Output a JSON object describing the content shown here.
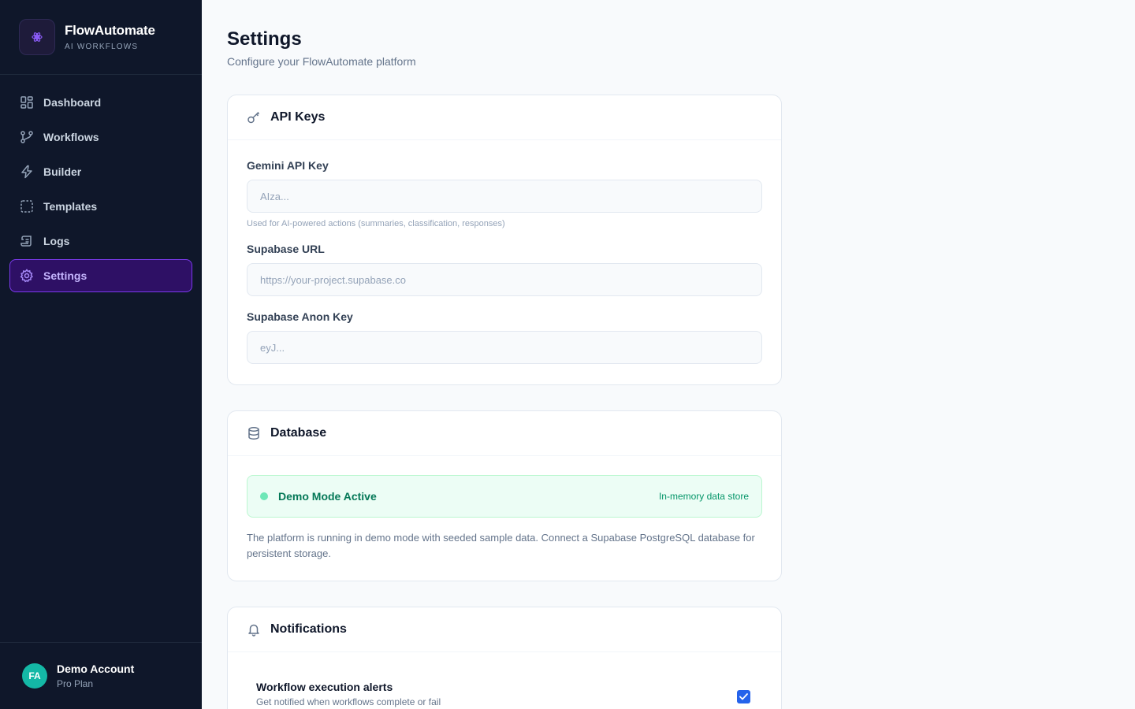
{
  "brand": {
    "name": "FlowAutomate",
    "tagline": "AI WORKFLOWS"
  },
  "nav": [
    {
      "label": "Dashboard",
      "icon": "dashboard-grid-icon"
    },
    {
      "label": "Workflows",
      "icon": "git-branch-icon"
    },
    {
      "label": "Builder",
      "icon": "lightning-icon"
    },
    {
      "label": "Templates",
      "icon": "template-dashed-icon"
    },
    {
      "label": "Logs",
      "icon": "scroll-icon"
    },
    {
      "label": "Settings",
      "icon": "gear-icon",
      "active": true
    }
  ],
  "account": {
    "initials": "FA",
    "name": "Demo Account",
    "plan": "Pro Plan"
  },
  "page": {
    "title": "Settings",
    "subtitle": "Configure your FlowAutomate platform"
  },
  "api_keys": {
    "title": "API Keys",
    "icon": "key-icon",
    "gemini": {
      "label": "Gemini API Key",
      "placeholder": "AIza...",
      "value": "",
      "help": "Used for AI-powered actions (summaries, classification, responses)"
    },
    "supabase_url": {
      "label": "Supabase URL",
      "placeholder": "https://your-project.supabase.co",
      "value": ""
    },
    "supabase_anon": {
      "label": "Supabase Anon Key",
      "placeholder": "eyJ...",
      "value": ""
    }
  },
  "database": {
    "title": "Database",
    "icon": "database-icon",
    "status_label": "Demo Mode Active",
    "status_detail": "In-memory data store",
    "description": "The platform is running in demo mode with seeded sample data. Connect a Supabase PostgreSQL database for persistent storage."
  },
  "notifications": {
    "title": "Notifications",
    "icon": "bell-icon",
    "items": [
      {
        "title": "Workflow execution alerts",
        "subtitle": "Get notified when workflows complete or fail",
        "checked": true
      }
    ]
  },
  "colors": {
    "sidebar_bg": "#0f172a",
    "accent": "#7c3aed",
    "success": "#047857",
    "checkbox": "#2563eb"
  }
}
